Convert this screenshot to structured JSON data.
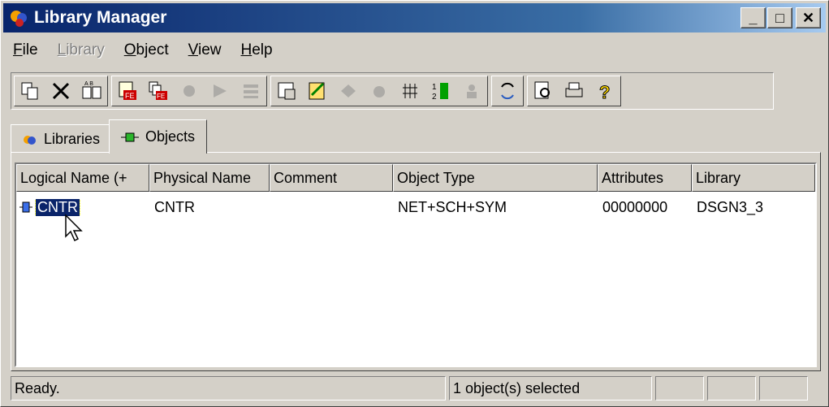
{
  "window": {
    "title": "Library Manager",
    "min_glyph": "_",
    "max_glyph": "□",
    "close_glyph": "✕"
  },
  "menu": [
    {
      "label": "File",
      "enabled": true
    },
    {
      "label": "Library",
      "enabled": false
    },
    {
      "label": "Object",
      "enabled": true
    },
    {
      "label": "View",
      "enabled": true
    },
    {
      "label": "Help",
      "enabled": true
    }
  ],
  "toolbar_icons": [
    "copy-icon",
    "delete-icon",
    "rename-icon",
    "fe-icon",
    "copy-fe-icon",
    "bug-icon",
    "arrow-icon",
    "gradient-icon",
    "properties-icon",
    "edit-icon",
    "package-icon",
    "pin-icon",
    "grid-icon",
    "sort-icon",
    "user-icon",
    "refresh-icon",
    "preview-icon",
    "print-icon",
    "help-icon"
  ],
  "tabs": [
    {
      "label": "Libraries",
      "active": false
    },
    {
      "label": "Objects",
      "active": true
    }
  ],
  "table": {
    "columns": [
      "Logical Name (+",
      "Physical Name",
      "Comment",
      "Object Type",
      "Attributes",
      "Library"
    ],
    "rows": [
      {
        "logical": "CNTR",
        "physical": "CNTR",
        "comment": "",
        "type": "NET+SCH+SYM",
        "attributes": "00000000",
        "library": "DSGN3_3"
      }
    ]
  },
  "status": {
    "left": "Ready.",
    "middle": "1 object(s) selected"
  }
}
